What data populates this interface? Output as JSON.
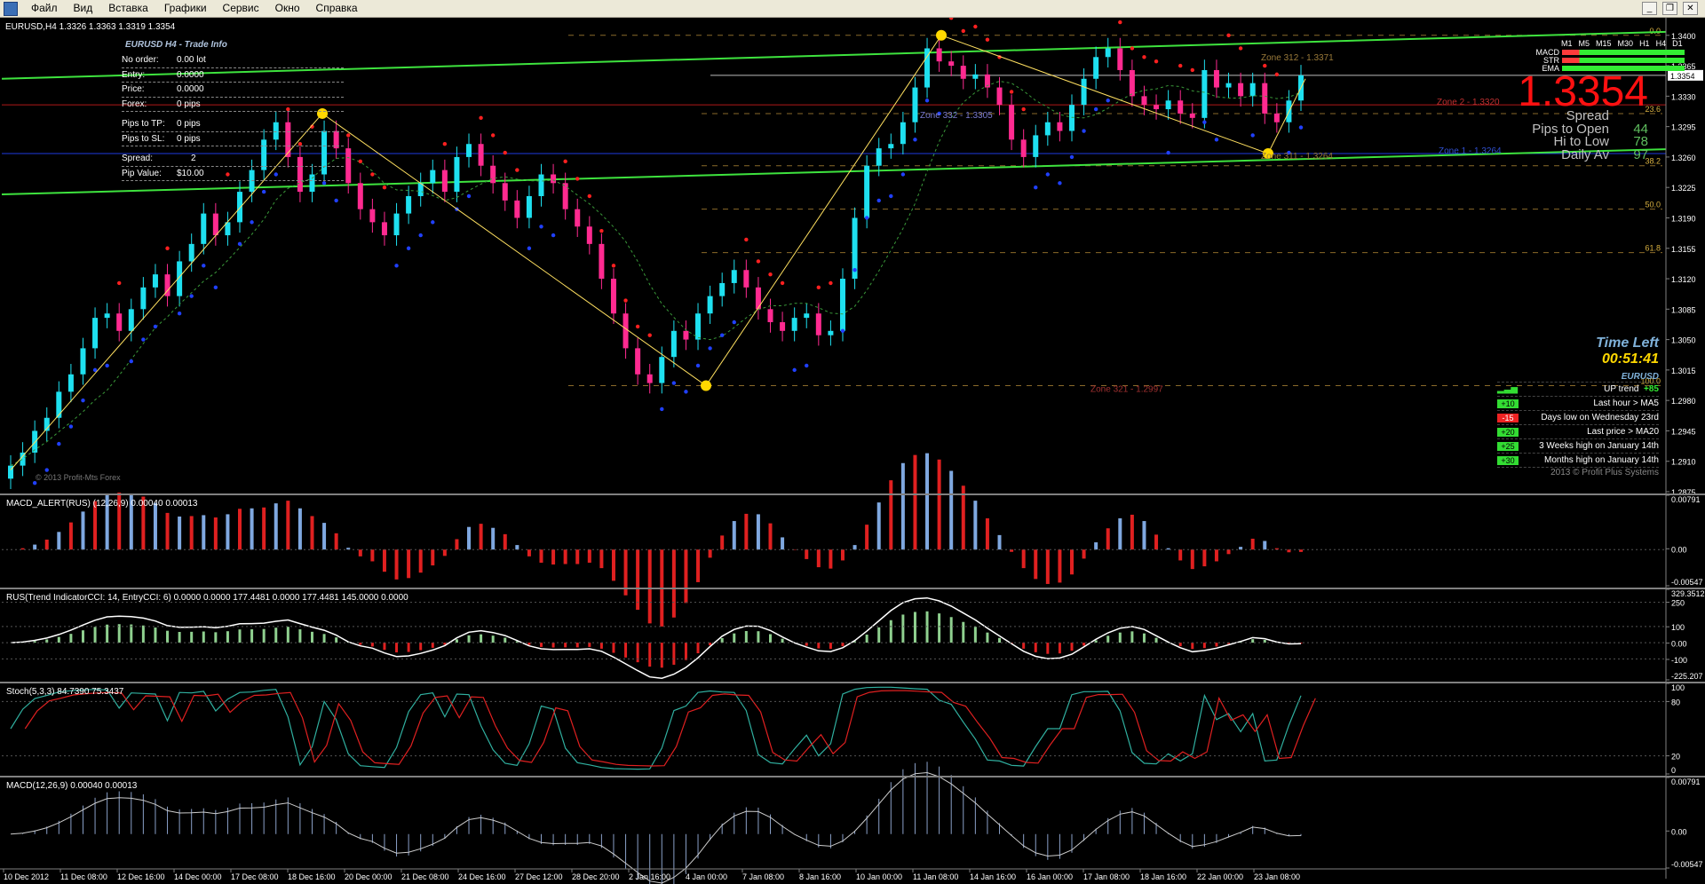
{
  "menu": {
    "items": [
      "Файл",
      "Вид",
      "Вставка",
      "Графики",
      "Сервис",
      "Окно",
      "Справка"
    ]
  },
  "header": {
    "symbol_line": "EURUSD,H4  1.3326 1.3363 1.3319 1.3354"
  },
  "trade_info": {
    "title": "EURUSD H4 - Trade Info",
    "no_order_label": "No order:",
    "no_order_value": "0.00 lot",
    "entry_label": "Entry:",
    "entry_value": "0.0000",
    "price_label": "Price:",
    "price_value": "0.0000",
    "forex_label": "Forex:",
    "forex_value": "0 pips",
    "pips_tp_label": "Pips to TP:",
    "pips_tp_value": "0 pips",
    "pips_sl_label": "Pips to SL:",
    "pips_sl_value": "0 pips",
    "spread_label": "Spread:",
    "spread_value": "2",
    "pip_value_label": "Pip Value:",
    "pip_value_value": "$10.00"
  },
  "signals": {
    "timeframes": [
      "M1",
      "M5",
      "M15",
      "M30",
      "H1",
      "H4",
      "D1"
    ],
    "rows": [
      {
        "name": "MACD",
        "color": "#ff3b3b"
      },
      {
        "name": "STR",
        "color": "#33ee33"
      },
      {
        "name": "EMA",
        "color": "#33ee33"
      }
    ]
  },
  "big_price": "1.3354",
  "stats": [
    {
      "label": "Spread",
      "value": ""
    },
    {
      "label": "Pips to Open",
      "value": "44"
    },
    {
      "label": "Hi to Low",
      "value": "78"
    },
    {
      "label": "Daily Av",
      "value": "97"
    }
  ],
  "time_left": {
    "label": "Time Left",
    "value": "00:51:41"
  },
  "trend_box": {
    "symbol": "EURUSD",
    "trend_label": "UP trend",
    "trend_value": "+85",
    "rows": [
      {
        "badge": "+10",
        "badge_color": "#33dd33",
        "text": "Last hour > MA5"
      },
      {
        "badge": "-15",
        "badge_color": "#ee2222",
        "text": "Days low on Wednesday 23rd"
      },
      {
        "badge": "+20",
        "badge_color": "#33dd33",
        "text": "Last price > MA20"
      },
      {
        "badge": "+25",
        "badge_color": "#33dd33",
        "text": "3 Weeks high on January 14th"
      },
      {
        "badge": "+30",
        "badge_color": "#33dd33",
        "text": "Months high on January 14th"
      }
    ],
    "copyright": "2013 © Profit Plus Systems"
  },
  "main_price_axis": [
    "1.3400",
    "1.3365",
    "1.3330",
    "1.3295",
    "1.3260",
    "1.3225",
    "1.3190",
    "1.3155",
    "1.3120",
    "1.3085",
    "1.3050",
    "1.3015",
    "1.2980",
    "1.2945",
    "1.2910",
    "1.2875"
  ],
  "current_price_tag": "1.3354",
  "fib_levels": [
    {
      "label": "0.0",
      "price": "1.3400"
    },
    {
      "label": "23.6",
      "price": "1.3310"
    },
    {
      "label": "38.2",
      "price": "1.3250"
    },
    {
      "label": "50.0",
      "price": "1.3200"
    },
    {
      "label": "61.8",
      "price": "1.3150"
    },
    {
      "label": "100.0",
      "price": "1.2997"
    }
  ],
  "zones": [
    {
      "label": "Zone 312 - 1.3371",
      "color": "#9a7a3a"
    },
    {
      "label": "Zone 2 - 1.3320",
      "color": "#c03030"
    },
    {
      "label": "Zone 332 - 1.3305",
      "color": "#7a7ad0"
    },
    {
      "label": "Zone 1 - 1.3264",
      "color": "#3050d0"
    },
    {
      "label": "Zone 311 - 1.3264",
      "color": "#9a7a3a"
    },
    {
      "label": "Zone 321 - 1.2997",
      "color": "#a03030"
    }
  ],
  "watermark": "© 2013 Profit-Mts Forex",
  "indicators": [
    {
      "title": "MACD_ALERT(RUS) (12,26,9)  0.00040 0.00013",
      "axis": [
        "0.00791",
        "0.00",
        "-0.00547"
      ]
    },
    {
      "title": "RUS(Trend IndicatorCCI: 14, EntryCCI: 6)  0.0000 0.0000 177.4481 0.0000 177.4481 145.0000 0.0000",
      "axis": [
        "329.3512",
        "250",
        "100",
        "0.00",
        "-100",
        "-225.207"
      ]
    },
    {
      "title": "Stoch(5,3,3)  84.7390 75.3437",
      "axis": [
        "100",
        "80",
        "20",
        "0"
      ]
    },
    {
      "title": "MACD(12,26,9)  0.00040 0.00013",
      "axis": [
        "0.00791",
        "0.00",
        "-0.00547"
      ]
    }
  ],
  "time_axis": [
    "10 Dec 2012",
    "11 Dec 08:00",
    "12 Dec 16:00",
    "14 Dec 00:00",
    "17 Dec 08:00",
    "18 Dec 16:00",
    "20 Dec 00:00",
    "21 Dec 08:00",
    "24 Dec 16:00",
    "27 Dec 12:00",
    "28 Dec 20:00",
    "2 Jan 16:00",
    "4 Jan 00:00",
    "7 Jan 08:00",
    "8 Jan 16:00",
    "10 Jan 00:00",
    "11 Jan 08:00",
    "14 Jan 16:00",
    "16 Jan 00:00",
    "17 Jan 08:00",
    "18 Jan 16:00",
    "22 Jan 00:00",
    "23 Jan 08:00"
  ],
  "chart_data": {
    "type": "candlestick",
    "symbol": "EURUSD",
    "timeframe": "H4",
    "last": {
      "open": 1.3326,
      "high": 1.3363,
      "low": 1.3319,
      "close": 1.3354
    },
    "ylim": [
      1.2875,
      1.341
    ],
    "closes": [
      1.2905,
      1.292,
      1.2945,
      1.296,
      1.299,
      1.301,
      1.304,
      1.3075,
      1.308,
      1.306,
      1.3085,
      1.311,
      1.3125,
      1.31,
      1.314,
      1.316,
      1.3195,
      1.317,
      1.3185,
      1.322,
      1.3245,
      1.328,
      1.33,
      1.326,
      1.322,
      1.324,
      1.329,
      1.327,
      1.323,
      1.32,
      1.3185,
      1.317,
      1.3195,
      1.3215,
      1.323,
      1.3245,
      1.322,
      1.326,
      1.3275,
      1.325,
      1.323,
      1.321,
      1.319,
      1.3215,
      1.324,
      1.323,
      1.32,
      1.318,
      1.316,
      1.312,
      1.308,
      1.304,
      1.301,
      1.3,
      1.303,
      1.306,
      1.305,
      1.308,
      1.31,
      1.3115,
      1.313,
      1.311,
      1.3085,
      1.307,
      1.306,
      1.3075,
      1.308,
      1.3055,
      1.306,
      1.312,
      1.319,
      1.325,
      1.327,
      1.3275,
      1.33,
      1.334,
      1.3385,
      1.337,
      1.3365,
      1.335,
      1.3355,
      1.334,
      1.332,
      1.328,
      1.326,
      1.3285,
      1.33,
      1.329,
      1.332,
      1.335,
      1.3375,
      1.3385,
      1.336,
      1.333,
      1.332,
      1.3315,
      1.3325,
      1.331,
      1.3305,
      1.336,
      1.334,
      1.3345,
      1.333,
      1.3345,
      1.331,
      1.33,
      1.3325,
      1.3354
    ]
  }
}
